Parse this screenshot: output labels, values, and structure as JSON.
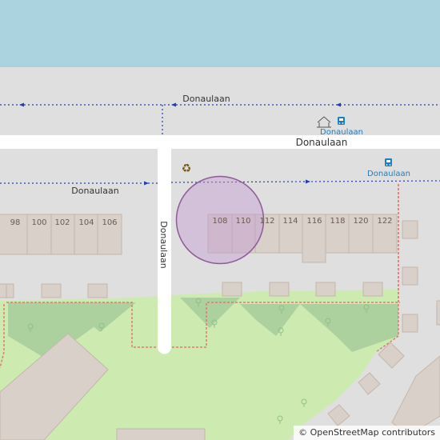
{
  "map": {
    "street_names": {
      "top_path": "Donaulaan",
      "main_road": "Donaulaan",
      "left_path": "Donaulaan",
      "vertical_road": "Donaulaan"
    },
    "bus_stops": [
      {
        "label": "Donaulaan"
      },
      {
        "label": "Donaulaan"
      }
    ],
    "recycling_icon": "♻",
    "bus_icon": "bus-stop-icon",
    "shelter_icon": "shelter-icon",
    "house_numbers": [
      "98",
      "100",
      "102",
      "104",
      "106",
      "108",
      "110",
      "112",
      "114",
      "116",
      "118",
      "120",
      "122"
    ],
    "colors": {
      "water": "#aad3df",
      "land": "#e0dfdf",
      "road": "#ffffff",
      "building": "#d9d0c9",
      "building_outline": "#c4b6ab",
      "grass": "#cdebb0",
      "forest_scrub": "#add19e",
      "path_dots": "#1f3eb8",
      "boundary": "#e07a6d",
      "marker_fill": "#c39bd3",
      "marker_stroke": "#8e5a9a",
      "bus_blue": "#1a7fc0",
      "recycle_green": "#7a5a1a"
    }
  },
  "attribution": {
    "symbol": "©",
    "text": "OpenStreetMap contributors"
  }
}
